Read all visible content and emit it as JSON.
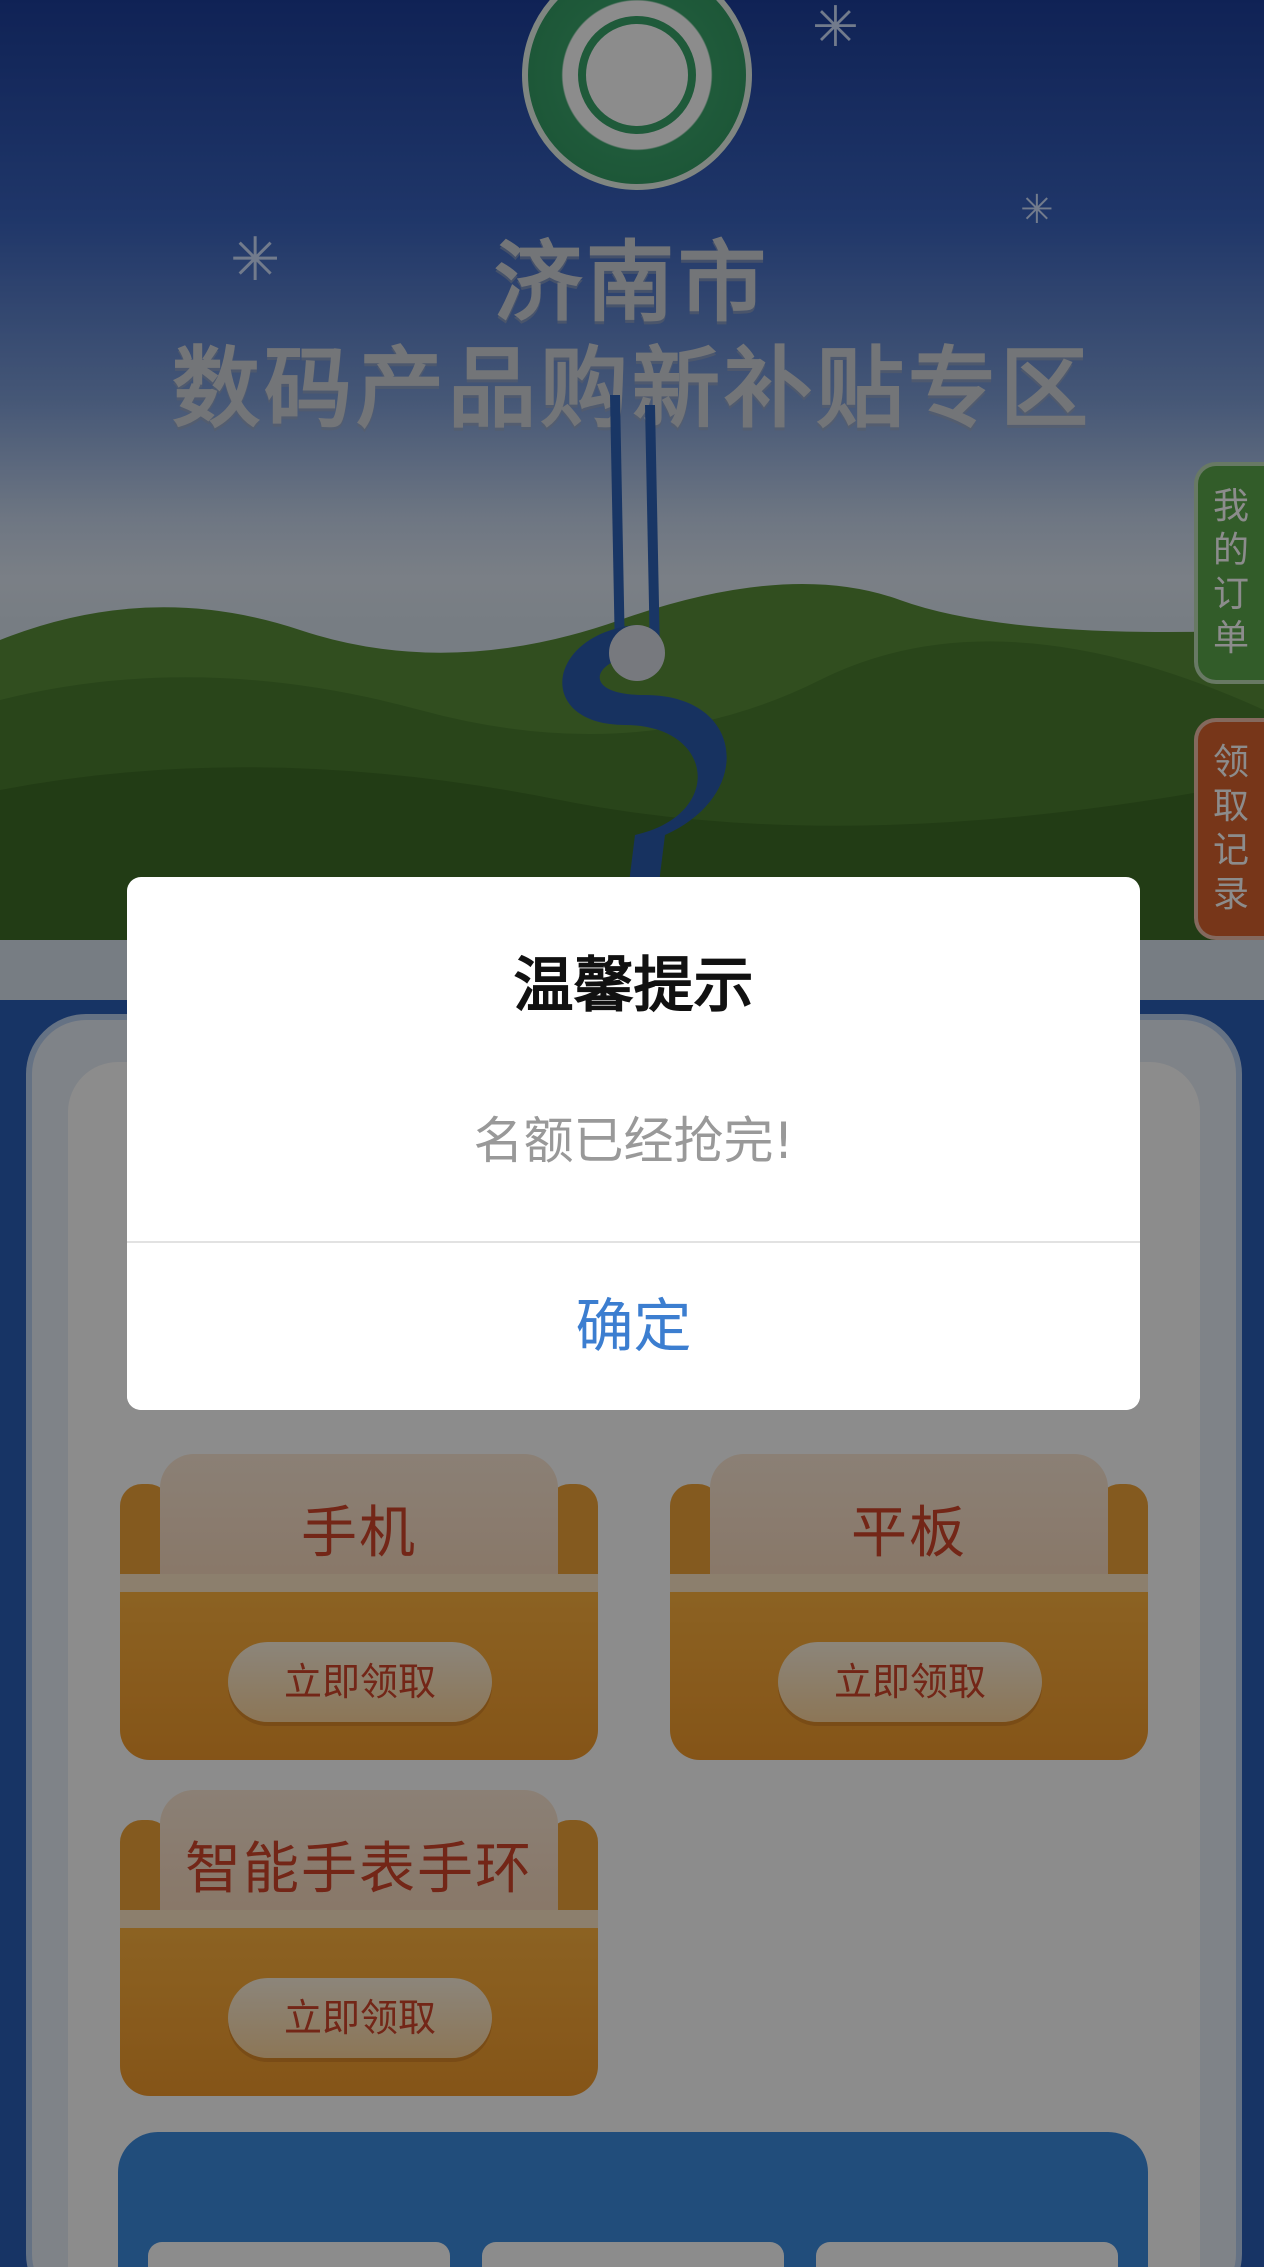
{
  "hero": {
    "title_line1": "济南市",
    "title_line2": "数码产品购新补贴专区",
    "badge_icon": "consumer-goods-trade-in-logo"
  },
  "side_tabs": {
    "orders": [
      "我",
      "的",
      "订",
      "单"
    ],
    "records": [
      "领",
      "取",
      "记",
      "录"
    ]
  },
  "cards": [
    {
      "name": "手机",
      "button": "立即领取"
    },
    {
      "name": "平板",
      "button": "立即领取"
    },
    {
      "name": "智能手表手环",
      "button": "立即领取"
    }
  ],
  "dialog": {
    "title": "温馨提示",
    "message": "名额已经抢完!",
    "confirm": "确定"
  },
  "colors": {
    "accent_blue": "#3c7ed0",
    "card_orange": "#f29a2c",
    "card_text_red": "#d2452b",
    "orders_tab_green": "#5ca84c",
    "records_tab_orange": "#d9632e"
  }
}
